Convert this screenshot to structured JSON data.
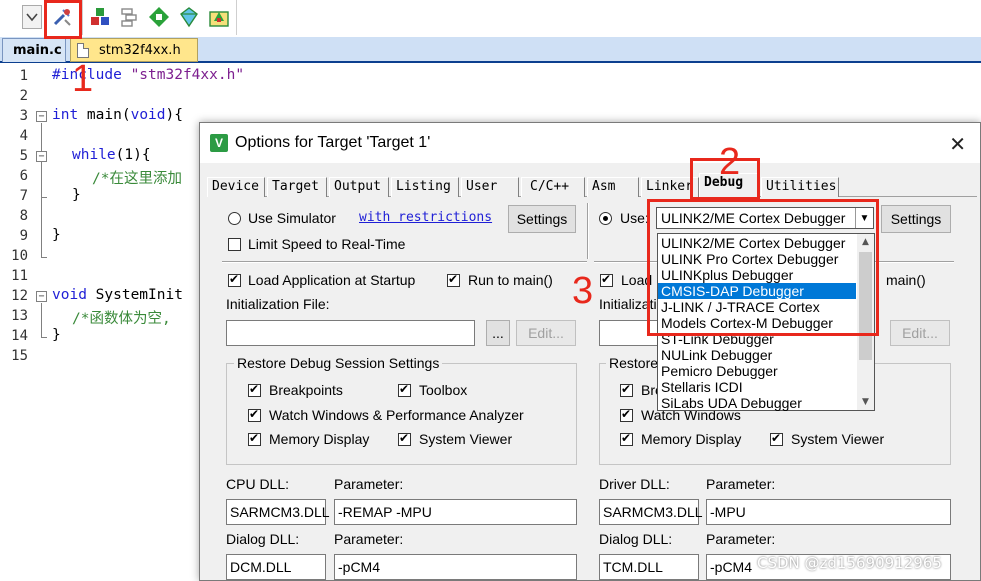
{
  "toolbar": {
    "icons": [
      "dropdown-arrow-icon",
      "options-for-target-icon",
      "manage-components-icon",
      "select-packs-icon",
      "pack-installer-icon",
      "project-icon",
      "batch-build-icon"
    ]
  },
  "annotations": {
    "step1": "1",
    "step2": "2",
    "step3": "3"
  },
  "editor": {
    "tabs": [
      {
        "label": "main.c"
      },
      {
        "label": "stm32f4xx.h"
      }
    ],
    "line_numbers": [
      "1",
      "2",
      "3",
      "4",
      "5",
      "6",
      "7",
      "8",
      "9",
      "10",
      "11",
      "12",
      "13",
      "14",
      "15"
    ],
    "lines": {
      "l1_kw": "#include",
      "l1_str": "\"stm32f4xx.h\"",
      "l3_kw": "int",
      "l3_rest": " main(",
      "l3_kw2": "void",
      "l3_end": "){",
      "l5_kw": "while",
      "l5_rest": "(1){",
      "l6_cm": "/*在这里添加",
      "l7": "}",
      "l9": "}",
      "l12_kw": "void",
      "l12_rest": " SystemInit",
      "l13_cm": "/*函数体为空,",
      "l14": "}"
    }
  },
  "dialog": {
    "title": "Options for Target 'Target 1'",
    "close": "✕",
    "tabs": [
      "Device",
      "Target",
      "Output",
      "Listing",
      "User",
      "C/C++",
      "Asm",
      "Linker",
      "Debug",
      "Utilities"
    ],
    "active_tab": "Debug",
    "left": {
      "use_simulator": "Use Simulator",
      "with_restrictions": "with restrictions",
      "settings": "Settings",
      "limit_speed": "Limit Speed to Real-Time",
      "load_app": "Load Application at Startup",
      "run_to_main": "Run to main()",
      "init_file": "Initialization File:",
      "browse": "...",
      "edit": "Edit...",
      "restore_group": "Restore Debug Session Settings",
      "breakpoints": "Breakpoints",
      "toolbox": "Toolbox",
      "watch_windows": "Watch Windows & Performance Analyzer",
      "memory_display": "Memory Display",
      "system_viewer": "System Viewer",
      "cpu_dll_label": "CPU DLL:",
      "cpu_param_label": "Parameter:",
      "cpu_dll": "SARMCM3.DLL",
      "cpu_param": "-REMAP -MPU",
      "dialog_dll_label": "Dialog DLL:",
      "dialog_param_label": "Parameter:",
      "dialog_dll": "DCM.DLL",
      "dialog_param": "-pCM4"
    },
    "right": {
      "use": "Use:",
      "selected_debugger": "ULINK2/ME Cortex Debugger",
      "settings": "Settings",
      "load": "Load",
      "run_main": "main()",
      "init": "Initializati",
      "edit": "Edit...",
      "restore": "Restore",
      "bre": "Bre",
      "watch_windows": "Watch Windows",
      "memory_display": "Memory Display",
      "system_viewer": "System Viewer",
      "driver_dll_label": "Driver DLL:",
      "driver_param_label": "Parameter:",
      "driver_dll": "SARMCM3.DLL",
      "driver_param": "-MPU",
      "dialog_dll_label": "Dialog DLL:",
      "dialog_param_label": "Parameter:",
      "dialog_dll": "TCM.DLL",
      "dialog_param": "-pCM4",
      "dropdown_options": [
        "ULINK2/ME Cortex Debugger",
        "ULINK Pro Cortex Debugger",
        "ULINKplus Debugger",
        "CMSIS-DAP Debugger",
        "J-LINK / J-TRACE Cortex",
        "Models Cortex-M Debugger",
        "ST-Link Debugger",
        "NULink Debugger",
        "Pemicro Debugger",
        "Stellaris ICDI",
        "SiLabs UDA Debugger"
      ],
      "highlighted_option": "CMSIS-DAP Debugger"
    }
  },
  "watermark": "CSDN @zd15690912965",
  "colors": {
    "annotation_red": "#e8281c",
    "selection_blue": "#0078d7",
    "keyword_blue": "#1f1fd6",
    "comment_green": "#3a8a3a"
  }
}
